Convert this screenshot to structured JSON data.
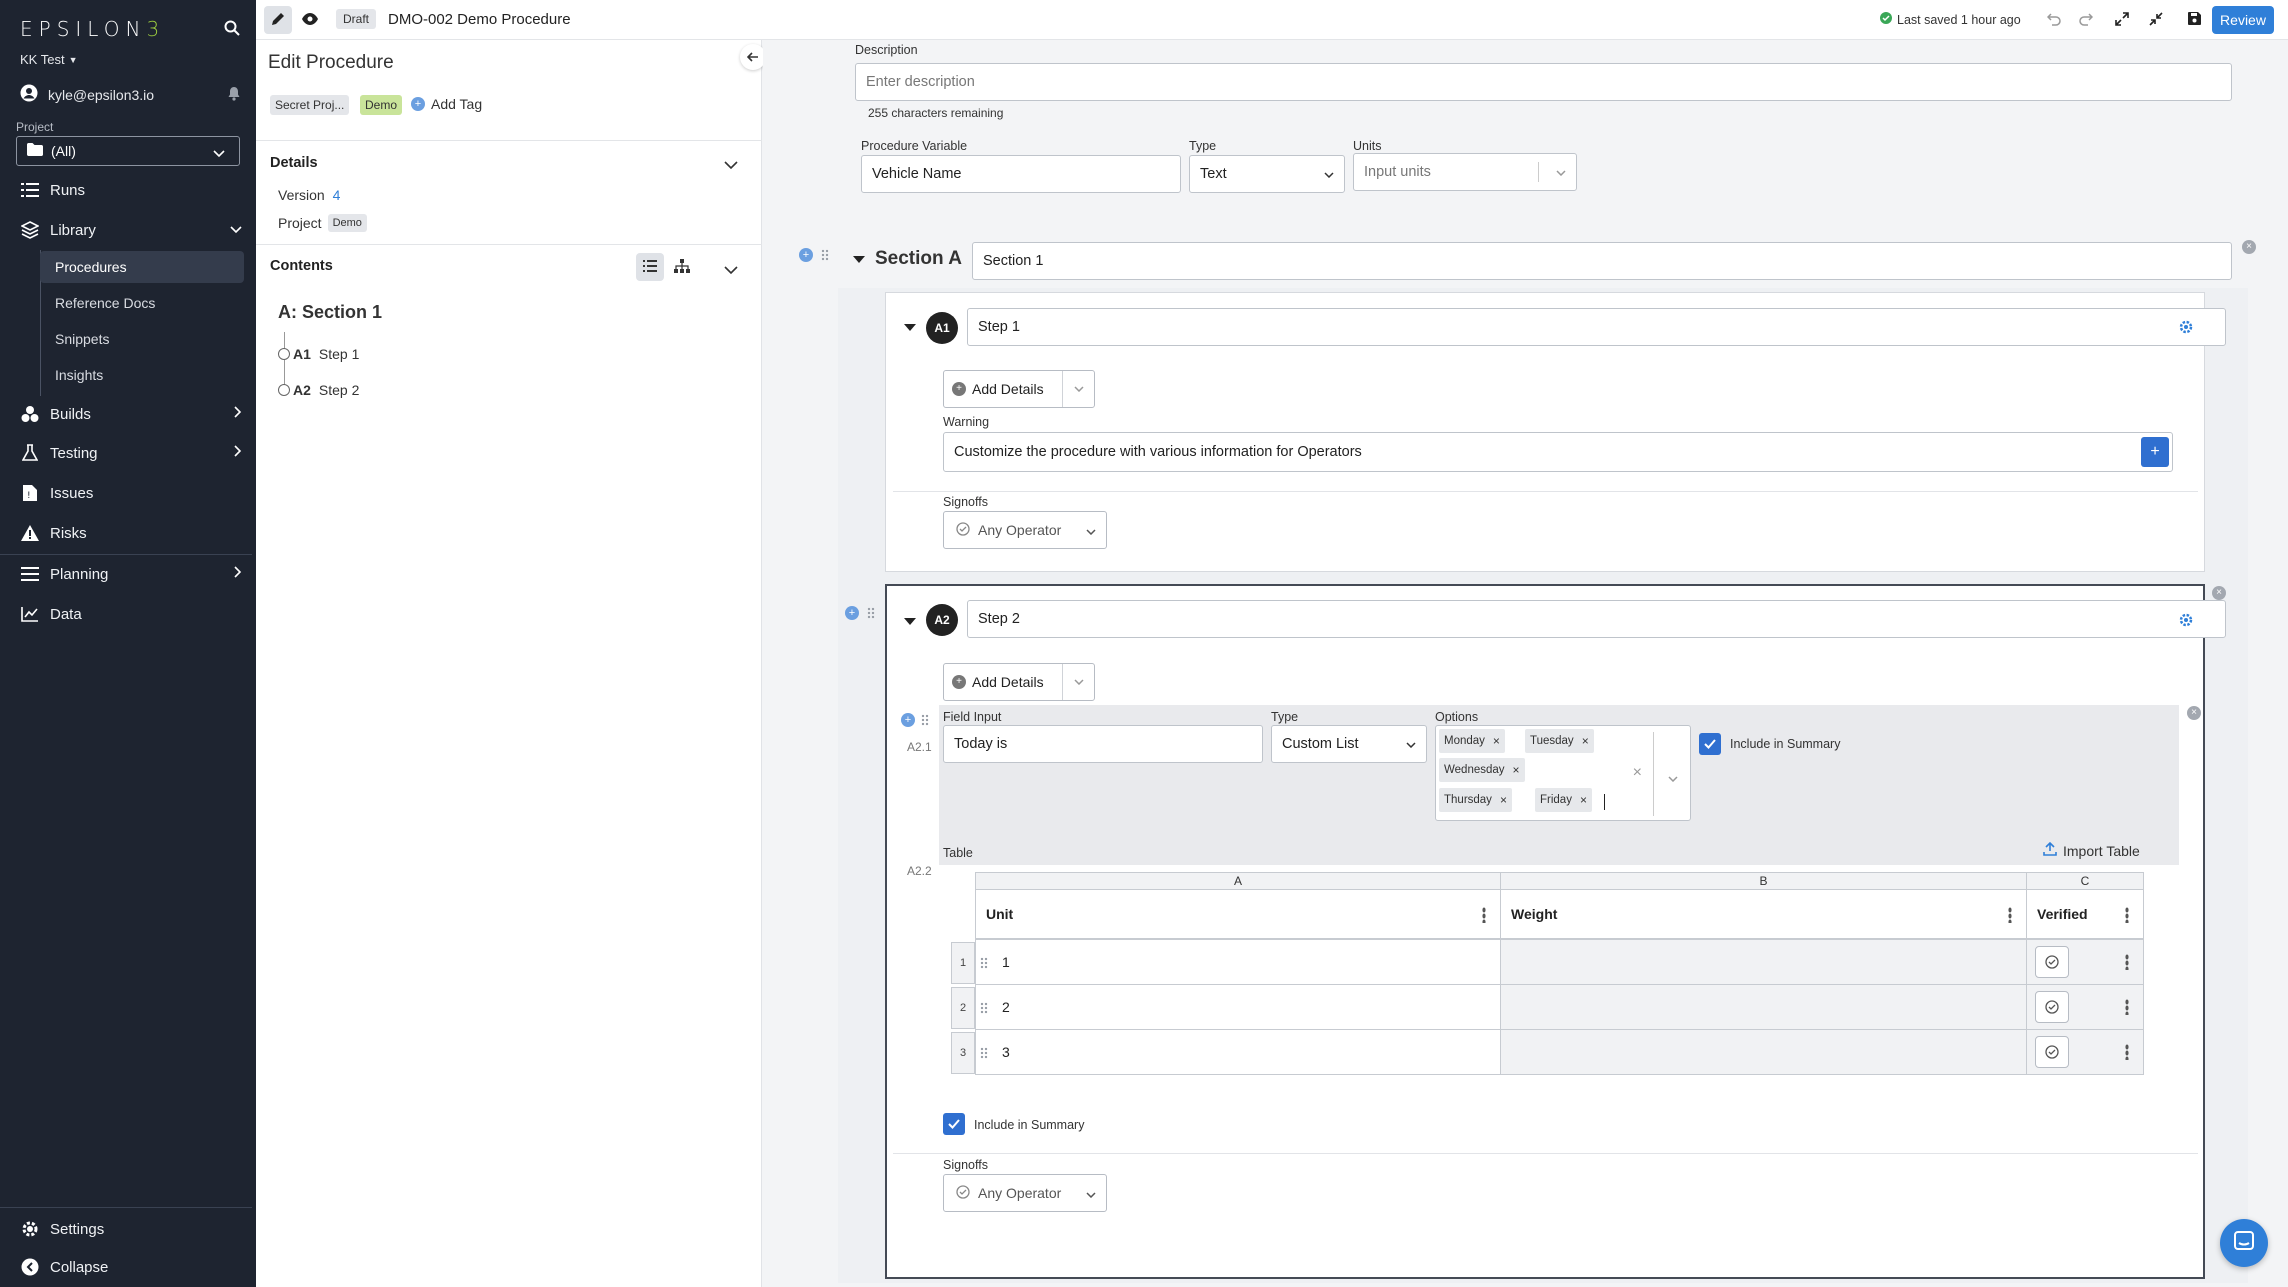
{
  "app": {
    "logo_text": "EPSILON3",
    "workspace": "KK Test",
    "user": "kyle@epsilon3.io"
  },
  "sidebar": {
    "project_label": "Project",
    "project_value": "(All)",
    "items": [
      {
        "label": "Runs",
        "icon": "list-icon"
      },
      {
        "label": "Library",
        "icon": "layers-icon"
      },
      {
        "label": "Builds",
        "icon": "cubes-icon"
      },
      {
        "label": "Testing",
        "icon": "flask-icon"
      },
      {
        "label": "Issues",
        "icon": "issue-doc-icon"
      },
      {
        "label": "Risks",
        "icon": "warning-icon"
      },
      {
        "label": "Planning",
        "icon": "menu-icon"
      },
      {
        "label": "Data",
        "icon": "chart-icon"
      }
    ],
    "library_sub": [
      "Procedures",
      "Reference Docs",
      "Snippets",
      "Insights"
    ],
    "settings": "Settings",
    "collapse": "Collapse"
  },
  "topbar": {
    "status": "Draft",
    "title": "DMO-002 Demo Procedure",
    "saved": "Last saved 1 hour ago",
    "review": "Review"
  },
  "left_panel": {
    "title": "Edit Procedure",
    "tags": [
      "Secret Proj...",
      "Demo"
    ],
    "add_tag": "Add Tag",
    "details_heading": "Details",
    "version_label": "Version",
    "version_value": "4",
    "project_label": "Project",
    "project_value": "Demo",
    "contents_heading": "Contents",
    "section_title": "A: Section 1",
    "outline": [
      {
        "key": "A1",
        "label": "Step 1"
      },
      {
        "key": "A2",
        "label": "Step 2"
      }
    ]
  },
  "editor": {
    "description_label": "Description",
    "description_placeholder": "Enter description",
    "chars_remaining": "255 characters remaining",
    "variable_label": "Procedure Variable",
    "variable_value": "Vehicle Name",
    "type_label": "Type",
    "type_value": "Text",
    "units_label": "Units",
    "units_placeholder": "Input units",
    "section_label": "Section A",
    "section_name": "Section 1",
    "step1": {
      "badge": "A1",
      "name": "Step 1",
      "add_details": "Add Details",
      "warning_label": "Warning",
      "warning_text": "Customize the procedure with various information for Operators",
      "signoffs_label": "Signoffs",
      "signoff_value": "Any Operator"
    },
    "step2": {
      "badge": "A2",
      "name": "Step 2",
      "add_details": "Add Details",
      "field_key": "A2.1",
      "field_input_label": "Field Input",
      "field_input_value": "Today is",
      "type_label": "Type",
      "type_value": "Custom List",
      "options_label": "Options",
      "options": [
        "Monday",
        "Tuesday",
        "Wednesday",
        "Thursday",
        "Friday"
      ],
      "include_summary": "Include in Summary",
      "table_key": "A2.2",
      "table_label": "Table",
      "import_table": "Import Table",
      "table_columns": [
        {
          "letter": "A",
          "name": "Unit"
        },
        {
          "letter": "B",
          "name": "Weight"
        },
        {
          "letter": "C",
          "name": "Verified"
        }
      ],
      "table_rows": [
        {
          "num": "1",
          "unit": "1"
        },
        {
          "num": "2",
          "unit": "2"
        },
        {
          "num": "3",
          "unit": "3"
        }
      ],
      "table_include_summary": "Include in Summary",
      "signoffs_label": "Signoffs",
      "signoff_value": "Any Operator"
    }
  },
  "colors": {
    "sidebar_bg": "#1e2430",
    "accent_blue": "#2f7fd8",
    "logo_green": "#9ccc3f",
    "tag_green": "#c9e49a"
  }
}
